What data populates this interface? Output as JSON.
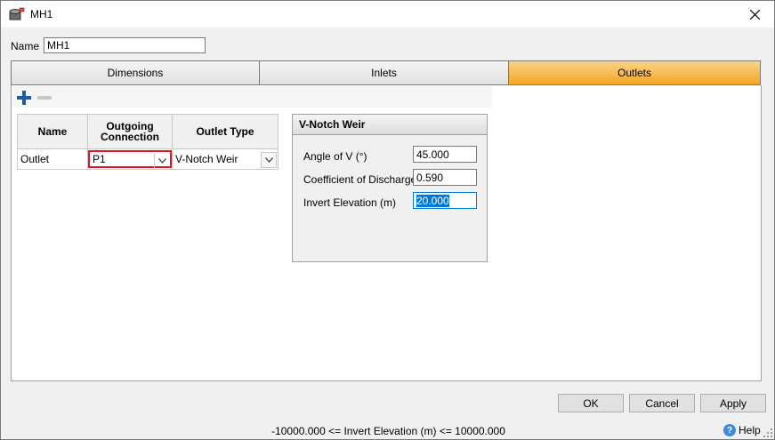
{
  "window": {
    "title": "MH1",
    "icon": "manhole-icon",
    "close_icon": "close-icon"
  },
  "name_field": {
    "label": "Name",
    "value": "MH1"
  },
  "tabs": [
    {
      "label": "Dimensions",
      "active": false
    },
    {
      "label": "Inlets",
      "active": false
    },
    {
      "label": "Outlets",
      "active": true
    }
  ],
  "toolbar": {
    "add_icon": "plus-icon",
    "remove_icon": "minus-icon"
  },
  "outlets_table": {
    "headers": {
      "name": "Name",
      "outgoing_line1": "Outgoing",
      "outgoing_line2": "Connection",
      "outlet_type": "Outlet Type"
    },
    "rows": [
      {
        "name": "Outlet",
        "outgoing_connection": "P1",
        "outlet_type": "V-Notch Weir"
      }
    ]
  },
  "weir": {
    "title": "V-Notch Weir",
    "fields": [
      {
        "label": "Angle of V (°)",
        "value": "45.000"
      },
      {
        "label": "Coefficient of Discharge",
        "value": "0.590"
      },
      {
        "label": "Invert Elevation (m)",
        "value": "20.000"
      }
    ]
  },
  "buttons": {
    "ok": "OK",
    "cancel": "Cancel",
    "apply": "Apply"
  },
  "status": {
    "text": "-10000.000 <= Invert Elevation (m) <= 10000.000",
    "help_label": "Help",
    "help_icon": "help-icon"
  },
  "colors": {
    "active_tab": "#f5a623",
    "error_border": "#e81123",
    "selection": "#0078d7",
    "add_icon": "#1e5aa8"
  }
}
